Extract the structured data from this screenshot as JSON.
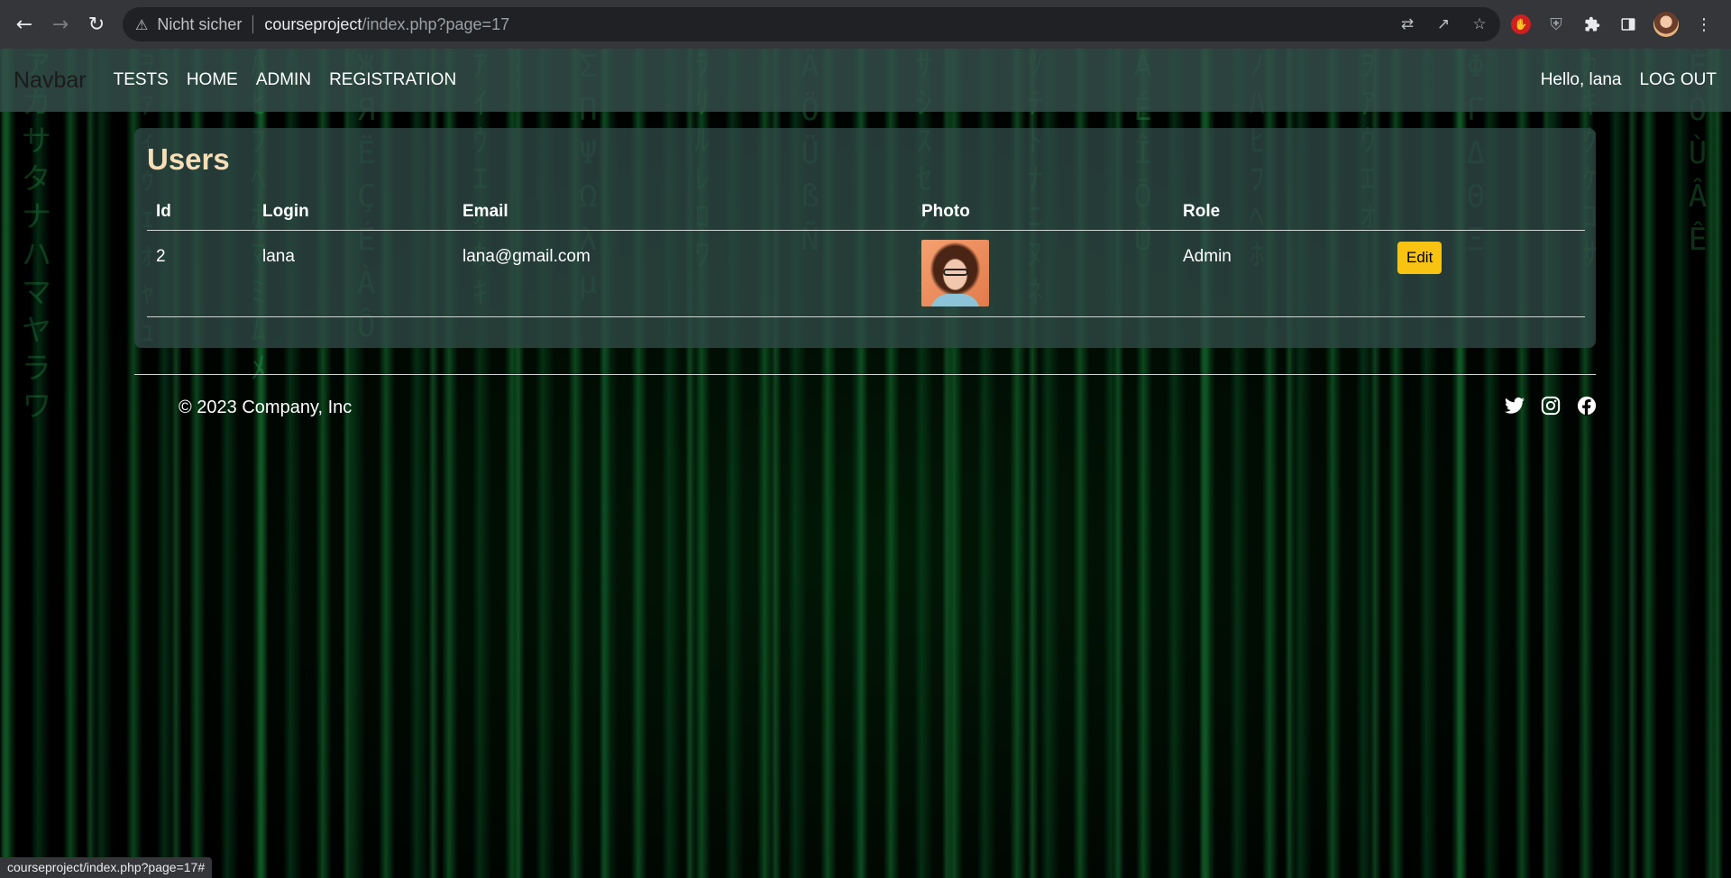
{
  "browser": {
    "security_label": "Nicht sicher",
    "url_host": "courseproject",
    "url_path": "/index.php?page=17",
    "status_url": "courseproject/index.php?page=17#"
  },
  "navbar": {
    "brand": "Navbar",
    "links": [
      "TESTS",
      "HOME",
      "ADMIN",
      "REGISTRATION"
    ],
    "greeting": "Hello, lana",
    "logout": "LOG OUT"
  },
  "users": {
    "title": "Users",
    "columns": [
      "Id",
      "Login",
      "Email",
      "Photo",
      "Role"
    ],
    "rows": [
      {
        "id": "2",
        "login": "lana",
        "email": "lana@gmail.com",
        "role": "Admin",
        "action": "Edit"
      }
    ]
  },
  "footer": {
    "copyright": "© 2023 Company, Inc",
    "social": [
      "twitter-icon",
      "instagram-icon",
      "facebook-icon"
    ]
  },
  "colors": {
    "title": "#f7deb6",
    "edit_button": "#f9c311",
    "navbar_bg": "#34504c"
  }
}
